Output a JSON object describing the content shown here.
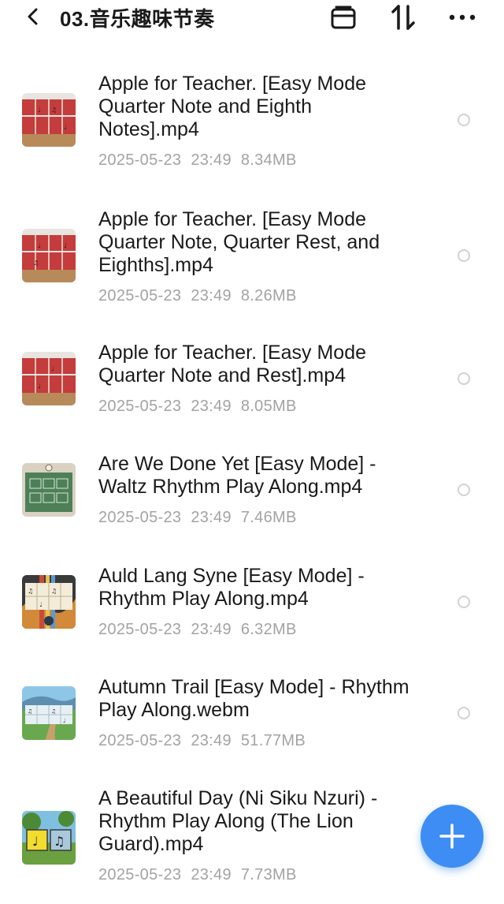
{
  "header": {
    "title": "03.音乐趣味节奏",
    "back_icon": "chevron-left-icon",
    "actions": [
      "archive-icon",
      "sort-icon",
      "more-icon"
    ]
  },
  "files": [
    {
      "name": "Apple for Teacher. [Easy Mode Quarter Note and Eighth Notes].mp4",
      "date": "2025-05-23",
      "time": "23:49",
      "size": "8.34MB"
    },
    {
      "name": "Apple for Teacher. [Easy Mode Quarter Note, Quarter Rest, and Eighths].mp4",
      "date": "2025-05-23",
      "time": "23:49",
      "size": "8.26MB"
    },
    {
      "name": "Apple for Teacher.  [Easy Mode Quarter Note and Rest].mp4",
      "date": "2025-05-23",
      "time": "23:49",
      "size": "8.05MB"
    },
    {
      "name": "Are We Done Yet [Easy Mode] - Waltz Rhythm Play Along.mp4",
      "date": "2025-05-23",
      "time": "23:49",
      "size": "7.46MB"
    },
    {
      "name": "Auld Lang Syne [Easy Mode] - Rhythm Play Along.mp4",
      "date": "2025-05-23",
      "time": "23:49",
      "size": "6.32MB"
    },
    {
      "name": "Autumn Trail [Easy Mode] - Rhythm Play Along.webm",
      "date": "2025-05-23",
      "time": "23:49",
      "size": "51.77MB"
    },
    {
      "name": "A Beautiful Day (Ni Siku Nzuri) - Rhythm Play Along (The Lion Guard).mp4",
      "date": "2025-05-23",
      "time": "23:49",
      "size": "7.73MB"
    }
  ],
  "fab": {
    "icon": "plus-icon"
  },
  "colors": {
    "accent": "#3d8df5",
    "meta": "#a3a3a3",
    "radio": "#d2d2d2"
  }
}
